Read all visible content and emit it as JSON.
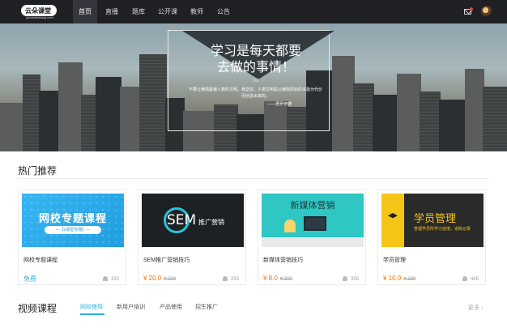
{
  "header": {
    "logo_text": "云朵课堂",
    "logo_sub": "yunduoketang.com",
    "nav": [
      {
        "label": "首页",
        "active": true
      },
      {
        "label": "直播",
        "active": false
      },
      {
        "label": "题库",
        "active": false
      },
      {
        "label": "公开课",
        "active": false
      },
      {
        "label": "教师",
        "active": false
      },
      {
        "label": "公告",
        "active": false
      }
    ],
    "icons": [
      "mail-icon",
      "avatar"
    ]
  },
  "banner": {
    "title_line1": "学习是每天都要",
    "title_line2": "去做的事情！",
    "mark": "lul",
    "quote": "不要让懒惰蒙蔽人类的文明，我坚信，人类文明是以懒惰原始的本能为代价而创造出来的。",
    "author": "——惠罗伊德"
  },
  "hot": {
    "title": "热门推荐",
    "cards": [
      {
        "image_main": "网校专题课程",
        "image_sub": "—【e课堂专题】—",
        "title": "网校专题课程",
        "price": "免费",
        "old_price": "",
        "count": "322",
        "free": true
      },
      {
        "image_main": "SEM",
        "image_sub": "推广营销",
        "title": "SEM推广营销技巧",
        "price": "¥ 20.0",
        "old_price": "¥ 200",
        "count": "253",
        "free": false
      },
      {
        "image_main": "新媒体营销",
        "image_sub": "",
        "title": "新媒体营销技巧",
        "price": "¥ 8.0",
        "old_price": "¥ 200",
        "count": "355",
        "free": false
      },
      {
        "image_main": "学员管理",
        "image_sub": "管理学员所学习进度，追踪记录",
        "title": "学员管理",
        "price": "¥ 10.0",
        "old_price": "¥ 200",
        "count": "445",
        "free": false
      }
    ]
  },
  "video": {
    "title": "视频课程",
    "tabs": [
      {
        "label": "网校使用",
        "active": true
      },
      {
        "label": "新用户培训",
        "active": false
      },
      {
        "label": "产品使用",
        "active": false
      },
      {
        "label": "招生推广",
        "active": false
      }
    ],
    "more": "更多 ›"
  },
  "colors": {
    "accent": "#2eb0e8",
    "price": "#ff6a00",
    "nav_bg": "#1f2024"
  }
}
